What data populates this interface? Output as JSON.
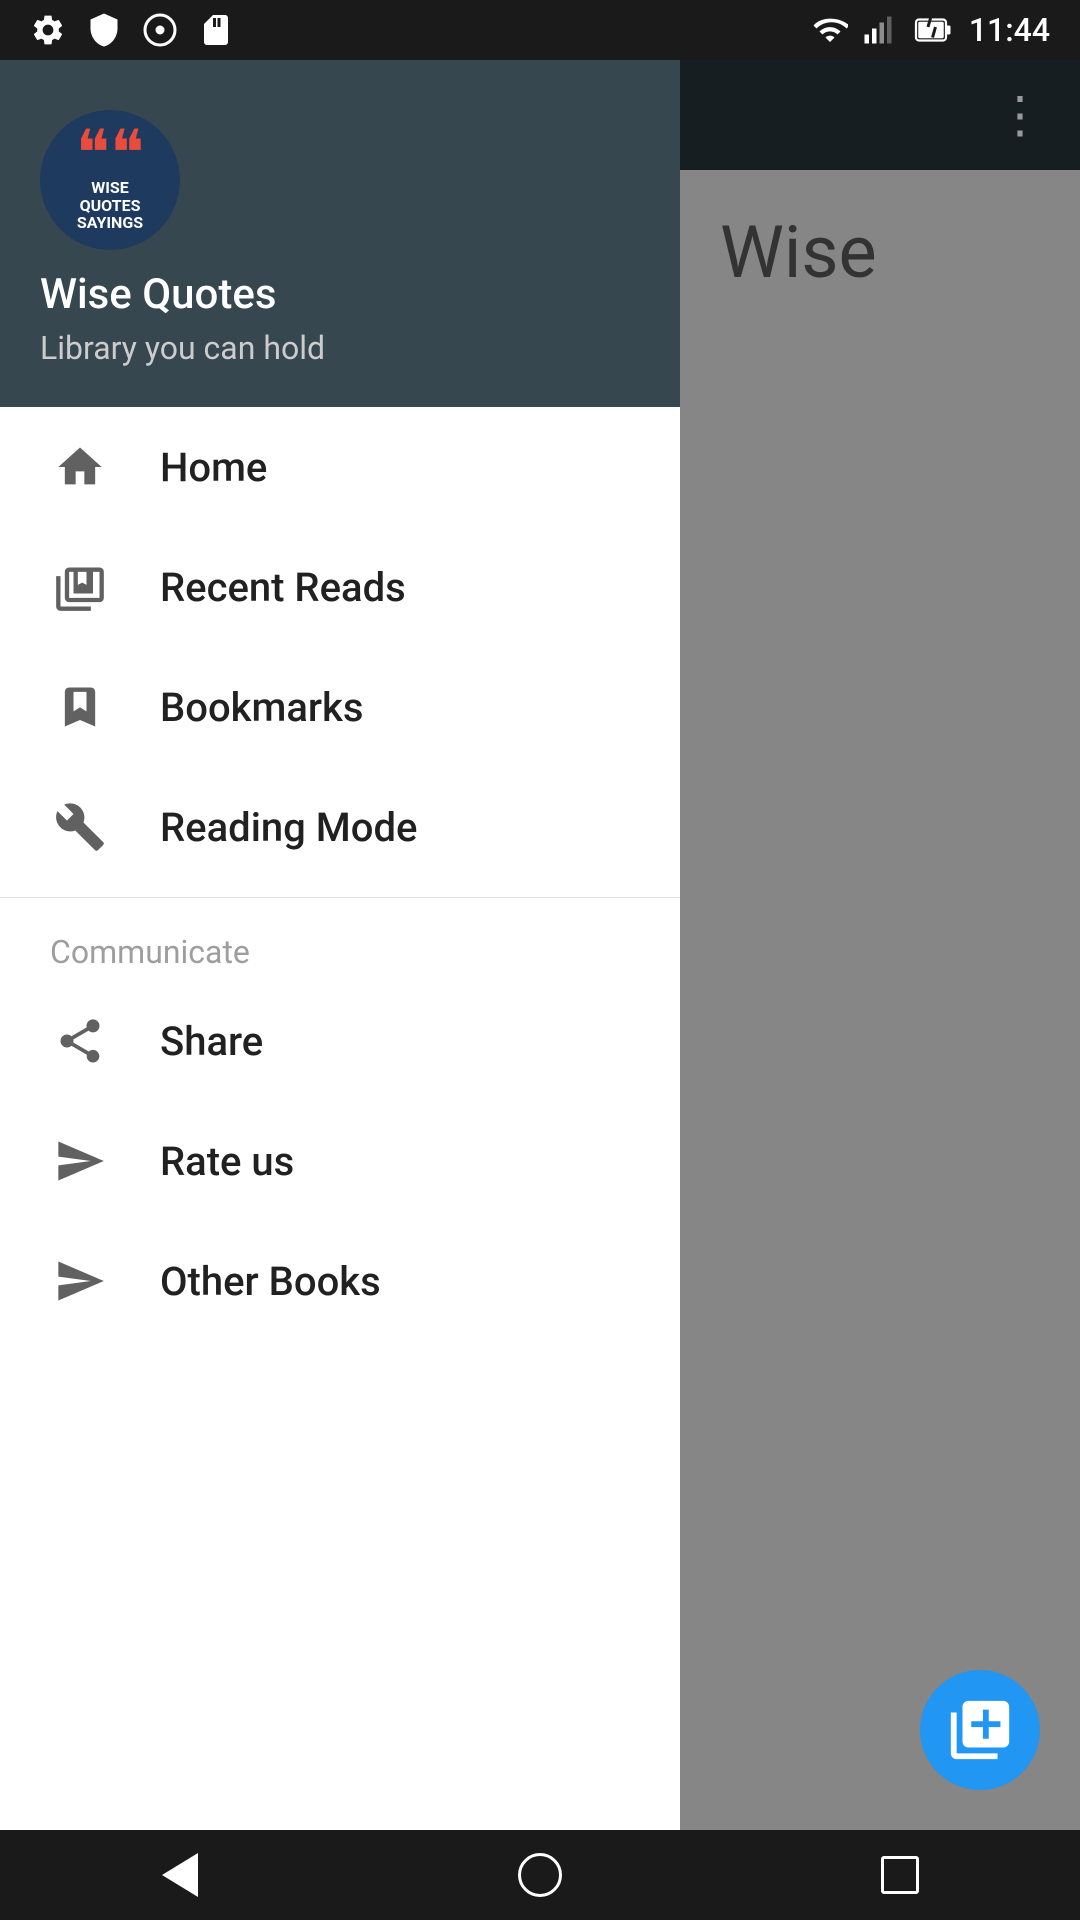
{
  "statusBar": {
    "time": "11:44",
    "icons": [
      "settings",
      "shield",
      "media",
      "clipboard"
    ]
  },
  "appBar": {
    "menuDots": "⋮"
  },
  "mainContent": {
    "partialText": "Wise"
  },
  "drawer": {
    "header": {
      "appTitle": "Wise Quotes",
      "appSubtitle": "Library you can hold",
      "logoTopText": "❝❝",
      "logoLine1": "WISE",
      "logoLine2": "QUOTES",
      "logoLine3": "SAYINGS"
    },
    "menuItems": [
      {
        "id": "home",
        "label": "Home",
        "icon": "home"
      },
      {
        "id": "recent-reads",
        "label": "Recent Reads",
        "icon": "recent"
      },
      {
        "id": "bookmarks",
        "label": "Bookmarks",
        "icon": "bookmark"
      },
      {
        "id": "reading-mode",
        "label": "Reading Mode",
        "icon": "wrench"
      }
    ],
    "sectionTitle": "Communicate",
    "communicateItems": [
      {
        "id": "share",
        "label": "Share",
        "icon": "share"
      },
      {
        "id": "rate-us",
        "label": "Rate us",
        "icon": "send"
      },
      {
        "id": "other-books",
        "label": "Other Books",
        "icon": "send"
      }
    ]
  },
  "fab": {
    "icon": "library"
  },
  "navBar": {
    "back": "back",
    "home": "home",
    "recent": "recent"
  }
}
